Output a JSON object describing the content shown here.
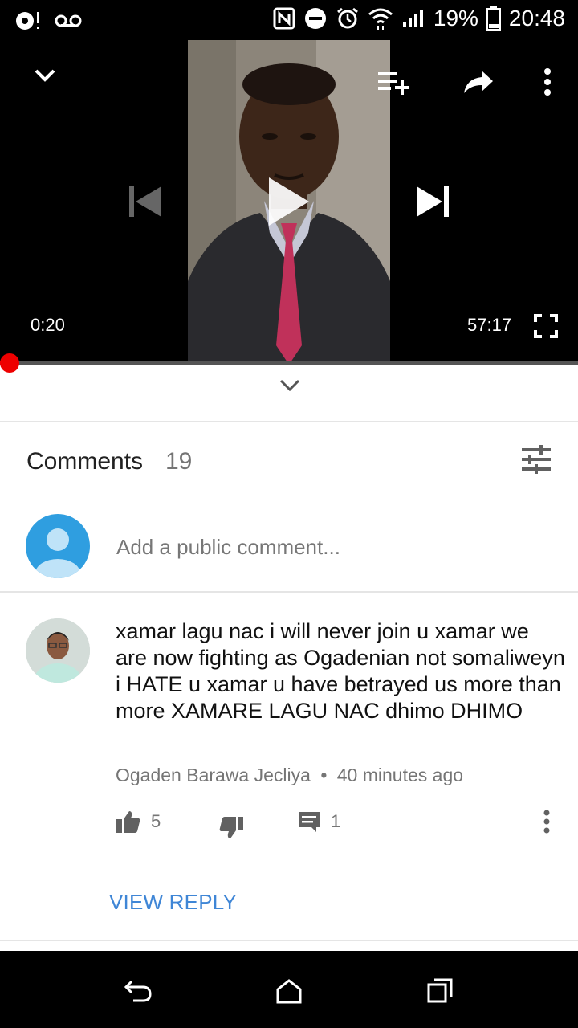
{
  "status_bar": {
    "battery_percent": "19%",
    "time": "20:48",
    "icons": [
      "notification-icon",
      "voicemail-icon",
      "nfc-icon",
      "do-not-disturb-icon",
      "alarm-icon",
      "wifi-icon",
      "signal-icon",
      "battery-icon"
    ]
  },
  "player": {
    "current_time": "0:20",
    "duration": "57:17",
    "progress_fraction": 0.006,
    "icons": [
      "collapse-icon",
      "add-to-playlist-icon",
      "share-icon",
      "more-icon",
      "previous-icon",
      "play-icon",
      "next-icon",
      "fullscreen-icon"
    ]
  },
  "comments": {
    "title": "Comments",
    "count": "19",
    "add_placeholder": "Add a public comment..."
  },
  "comment_1": {
    "text": "xamar lagu nac i will never join u xamar we are now fighting as Ogadenian not somaliweyn i HATE u xamar u have betrayed us more than more XAMARE LAGU NAC dhimo DHIMO",
    "author": "Ogaden Barawa Jecliya",
    "separator": "•",
    "time_ago": "40 minutes ago",
    "likes": "5",
    "replies": "1",
    "view_reply": "VIEW REPLY"
  },
  "colors": {
    "accent_red": "#e00000",
    "link_blue": "#3f86d6",
    "avatar_blue": "#2f9ee0"
  }
}
